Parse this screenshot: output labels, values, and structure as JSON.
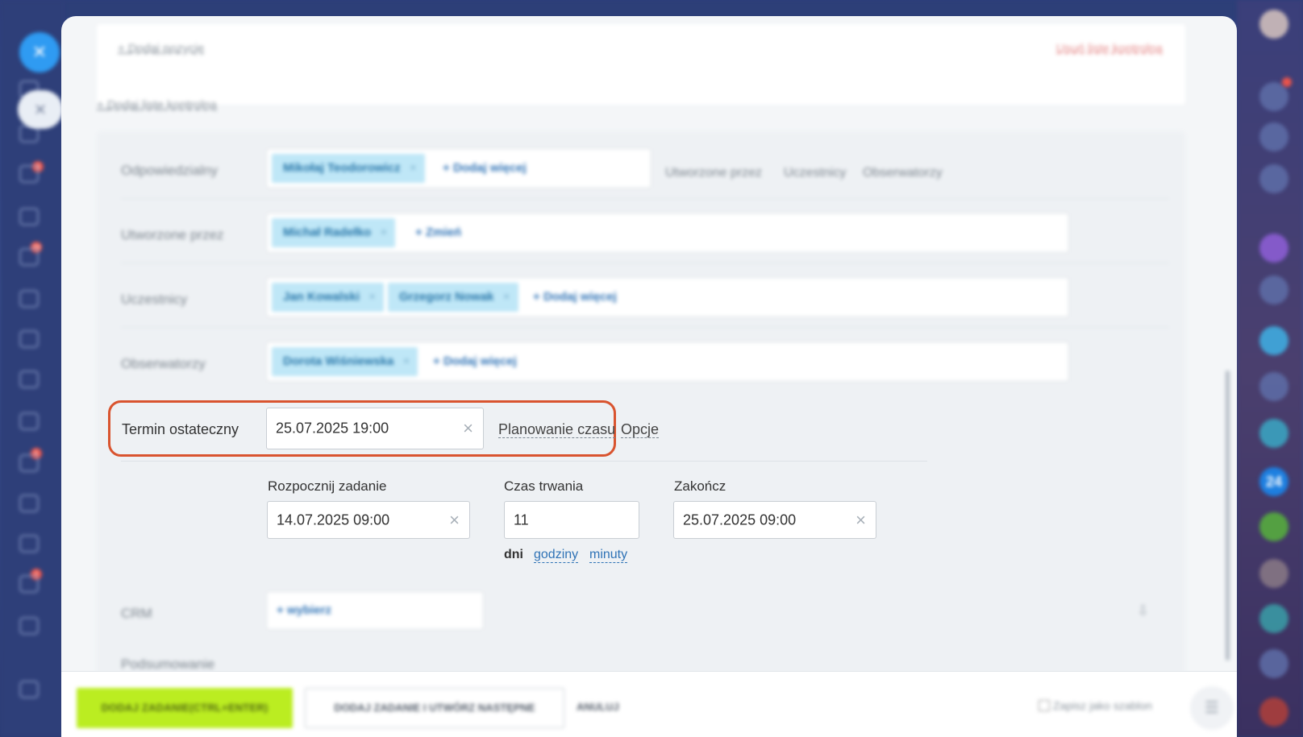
{
  "checklist": {
    "add_position": "Dodaj pozycję",
    "delete_checklist": "Usuń listę kontrolną",
    "add_checklist": "Dodaj listę kontrolną"
  },
  "responsible": {
    "label": "Odpowiedzialny",
    "person": "Mikołaj Teodorowicz",
    "add_more": "Dodaj więcej",
    "roles": [
      "Utworzone przez",
      "Uczestnicy",
      "Obserwatorzy"
    ]
  },
  "created_by": {
    "label": "Utworzone przez",
    "person": "Michał Radełko",
    "change": "Zmień"
  },
  "participants": {
    "label": "Uczestnicy",
    "people": [
      "Jan Kowalski",
      "Grzegorz Nowak"
    ],
    "add_more": "Dodaj więcej"
  },
  "observers": {
    "label": "Obserwatorzy",
    "person": "Dorota Wiśniewska",
    "add_more": "Dodaj więcej"
  },
  "deadline": {
    "label": "Termin ostateczny",
    "value": "25.07.2025 19:00",
    "time_planning": "Planowanie czasu",
    "options": "Opcje"
  },
  "planning": {
    "start_label": "Rozpocznij zadanie",
    "start_value": "14.07.2025 09:00",
    "duration_label": "Czas trwania",
    "duration_value": "11",
    "end_label": "Zakończ",
    "end_value": "25.07.2025 09:00",
    "units": {
      "days": "dni",
      "hours": "godziny",
      "minutes": "minuty"
    }
  },
  "crm": {
    "label": "CRM",
    "select": "wybierz"
  },
  "summary": {
    "label": "Podsumowanie"
  },
  "footer": {
    "primary": "DODAJ ZADANIE(CTRL+ENTER)",
    "secondary": "DODAJ ZADANIE I UTWÓRZ NASTĘPNE",
    "cancel": "ANULUJ",
    "save_template": "Zapisz jako szablon"
  },
  "sidebar": {
    "badges": [
      "4",
      "3",
      "29",
      "5",
      "2"
    ],
    "right_badge_24": "24"
  },
  "colors": {
    "primary_button": "#bbed21",
    "highlight": "#d9542f",
    "chip": "#bfe7f7",
    "link": "#2f73b6"
  }
}
